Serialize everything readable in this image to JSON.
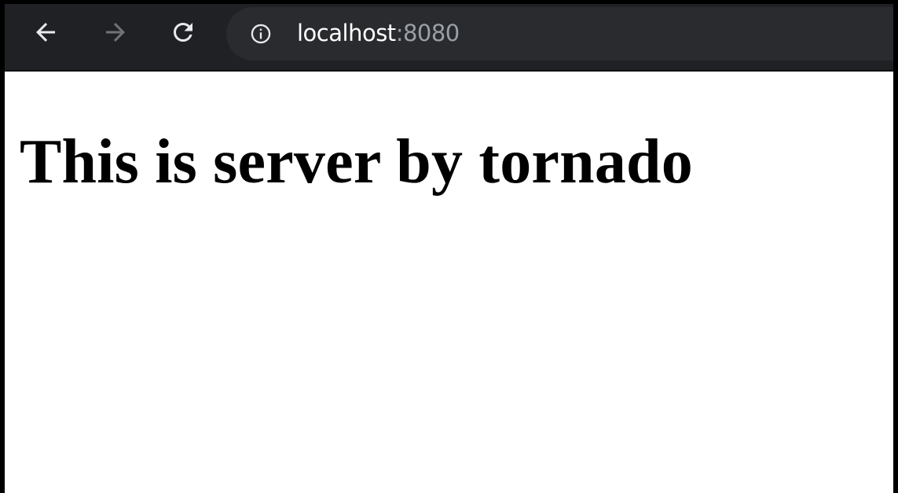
{
  "browser": {
    "toolbar": {
      "back_icon": "arrow-left-icon",
      "forward_icon": "arrow-right-icon",
      "reload_icon": "reload-icon",
      "info_icon": "info-icon"
    },
    "address_bar": {
      "host": "localhost",
      "port": ":8080"
    },
    "colors": {
      "toolbar_bg": "#202124",
      "omnibox_bg": "#292b2e",
      "icon_active": "#e8eaed",
      "icon_disabled": "#6f7378",
      "port_text": "#9aa0a6"
    }
  },
  "page": {
    "heading": "This is server by tornado"
  }
}
